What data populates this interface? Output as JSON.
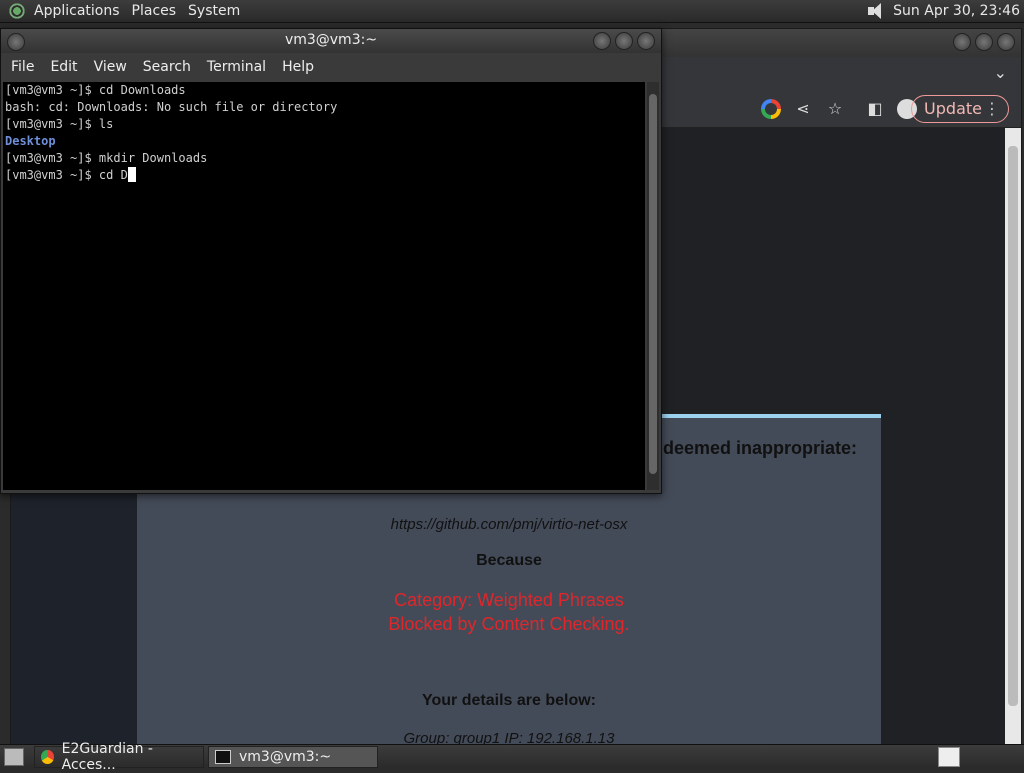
{
  "top_panel": {
    "menus": [
      "Applications",
      "Places",
      "System"
    ],
    "clock": "Sun Apr 30, 23:46"
  },
  "browser": {
    "update_label": "Update",
    "tab_dropdown": "⌄",
    "block_page": {
      "heading": "deemed inappropriate:",
      "url": "https://github.com/pmj/virtio-net-osx",
      "because": "Because",
      "reason_line1": "Category: Weighted Phrases",
      "reason_line2": "Blocked by Content Checking.",
      "details_heading": "Your details are below:",
      "group_line": "Group: group1   IP: 192.168.1.13"
    }
  },
  "terminal": {
    "title": "vm3@vm3:~",
    "menus": [
      "File",
      "Edit",
      "View",
      "Search",
      "Terminal",
      "Help"
    ],
    "lines": [
      "[vm3@vm3 ~]$ cd Downloads",
      "bash: cd: Downloads: No such file or directory",
      "[vm3@vm3 ~]$ ls",
      "Desktop",
      "[vm3@vm3 ~]$ mkdir Downloads",
      "[vm3@vm3 ~]$ cd D"
    ]
  },
  "taskbar": {
    "tasks": [
      "E2Guardian - Acces...",
      "vm3@vm3:~"
    ]
  }
}
